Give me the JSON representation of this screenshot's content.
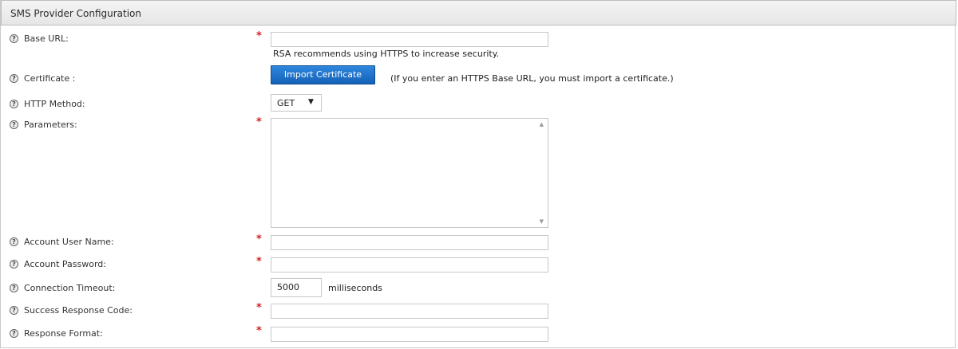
{
  "panel": {
    "title": "SMS Provider Configuration"
  },
  "fields": {
    "base_url": {
      "label": "Base URL:",
      "value": "",
      "hint": "RSA recommends using HTTPS to increase security."
    },
    "certificate": {
      "label": "Certificate :",
      "button": "Import Certificate",
      "note": "(If you enter an HTTPS Base URL, you must import a certificate.)"
    },
    "http_method": {
      "label": "HTTP Method:",
      "selected": "GET"
    },
    "parameters": {
      "label": "Parameters:",
      "value": ""
    },
    "account_user_name": {
      "label": "Account User Name:",
      "value": ""
    },
    "account_password": {
      "label": "Account Password:",
      "value": ""
    },
    "connection_timeout": {
      "label": "Connection Timeout:",
      "value": "5000",
      "unit": "milliseconds"
    },
    "success_response_code": {
      "label": "Success Response Code:",
      "value": ""
    },
    "response_format": {
      "label": "Response Format:",
      "value": ""
    }
  },
  "icons": {
    "help": "help-icon",
    "required": "required-asterisk"
  },
  "glyphs": {
    "help": "?",
    "required": "*",
    "dropdown": "▼",
    "scroll_up": "▲",
    "scroll_down": "▼"
  },
  "colors": {
    "button": "#1f6fc8",
    "required": "#d42020",
    "header": "#ececec"
  }
}
